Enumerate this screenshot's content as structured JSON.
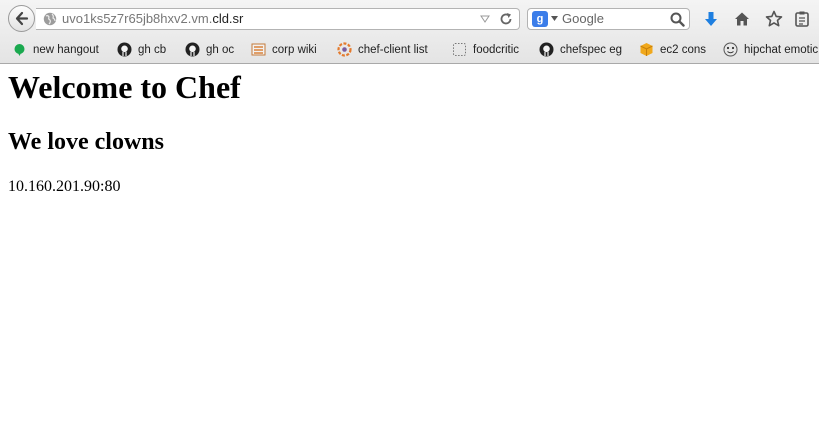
{
  "browser": {
    "url": {
      "prefix": "uvo1ks5z7r65jb8hxv2.vm.",
      "host": "cld.sr"
    },
    "search": {
      "placeholder": "Google",
      "engine_icon": "g"
    },
    "icons": {
      "back": "back-arrow-icon",
      "globe": "globe-icon",
      "dropdown": "dropdown-icon",
      "reload": "reload-icon",
      "search": "magnifier-icon",
      "download": "download-arrow-icon",
      "home": "home-icon",
      "bookmark_star": "star-icon",
      "reading_list": "clipboard-icon"
    },
    "bookmarks": [
      {
        "label": "new hangout",
        "icon": "green-dot-icon"
      },
      {
        "label": "gh cb",
        "icon": "github-icon"
      },
      {
        "label": "gh oc",
        "icon": "github-icon"
      },
      {
        "label": "corp wiki",
        "icon": "wiki-icon"
      },
      {
        "label": "chef-client list",
        "icon": "chef-icon"
      },
      {
        "label": "foodcritic",
        "icon": "dotted-square-icon"
      },
      {
        "label": "chefspec eg",
        "icon": "github-icon"
      },
      {
        "label": "ec2 cons",
        "icon": "cube-icon"
      },
      {
        "label": "hipchat emotic",
        "icon": "face-icon"
      }
    ],
    "colors": {
      "download_arrow": "#1e7fe0",
      "search_engine": "#3b7de9"
    }
  },
  "page": {
    "heading": "Welcome to Chef",
    "subheading": "We love clowns",
    "address": "10.160.201.90:80"
  }
}
